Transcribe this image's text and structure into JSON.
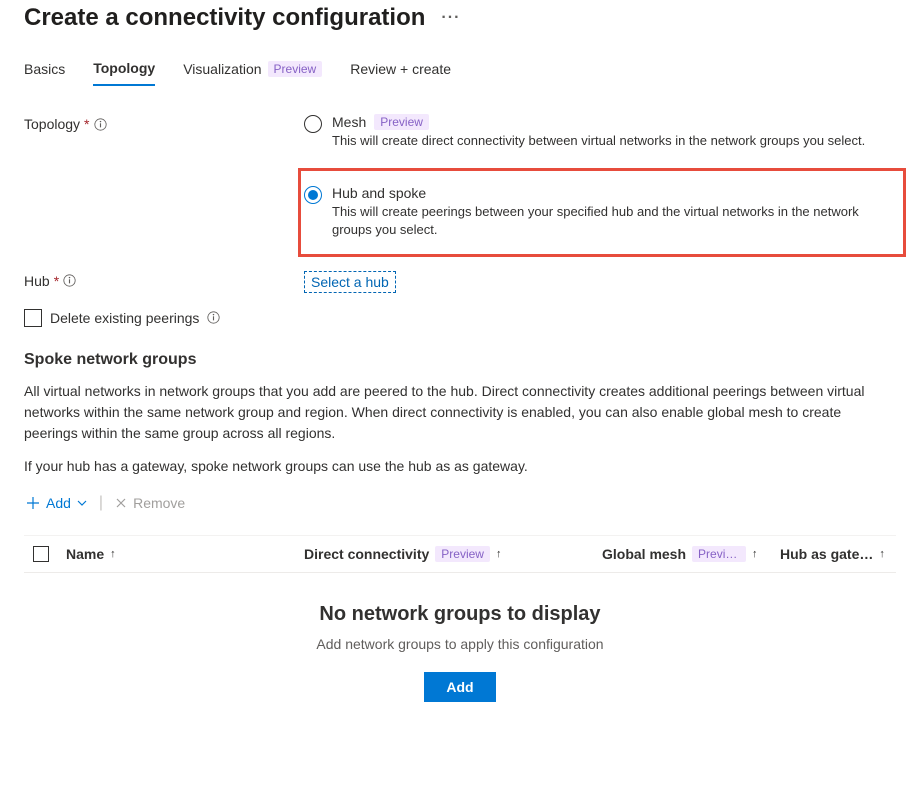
{
  "page": {
    "title": "Create a connectivity configuration"
  },
  "tabs": {
    "basics": "Basics",
    "topology": "Topology",
    "visualization": "Visualization",
    "visualization_badge": "Preview",
    "review": "Review + create"
  },
  "fields": {
    "topology_label": "Topology",
    "hub_label": "Hub",
    "select_hub": "Select a hub",
    "delete_peerings": "Delete existing peerings"
  },
  "topology_options": {
    "mesh": {
      "title": "Mesh",
      "badge": "Preview",
      "desc": "This will create direct connectivity between virtual networks in the network groups you select."
    },
    "hubspoke": {
      "title": "Hub and spoke",
      "desc": "This will create peerings between your specified hub and the virtual networks in the network groups you select."
    }
  },
  "spoke_section": {
    "title": "Spoke network groups",
    "desc1": "All virtual networks in network groups that you add are peered to the hub. Direct connectivity creates additional peerings between virtual networks within the same network group and region. When direct connectivity is enabled, you can also enable global mesh to create peerings within the same group across all regions.",
    "desc2": "If your hub has a gateway, spoke network groups can use the hub as as gateway."
  },
  "toolbar": {
    "add": "Add",
    "remove": "Remove"
  },
  "table": {
    "name": "Name",
    "direct": "Direct connectivity",
    "direct_badge": "Preview",
    "global": "Global mesh",
    "global_badge": "Preview",
    "hub_gateway": "Hub as gate…"
  },
  "empty": {
    "title": "No network groups to display",
    "desc": "Add network groups to apply this configuration",
    "button": "Add"
  }
}
